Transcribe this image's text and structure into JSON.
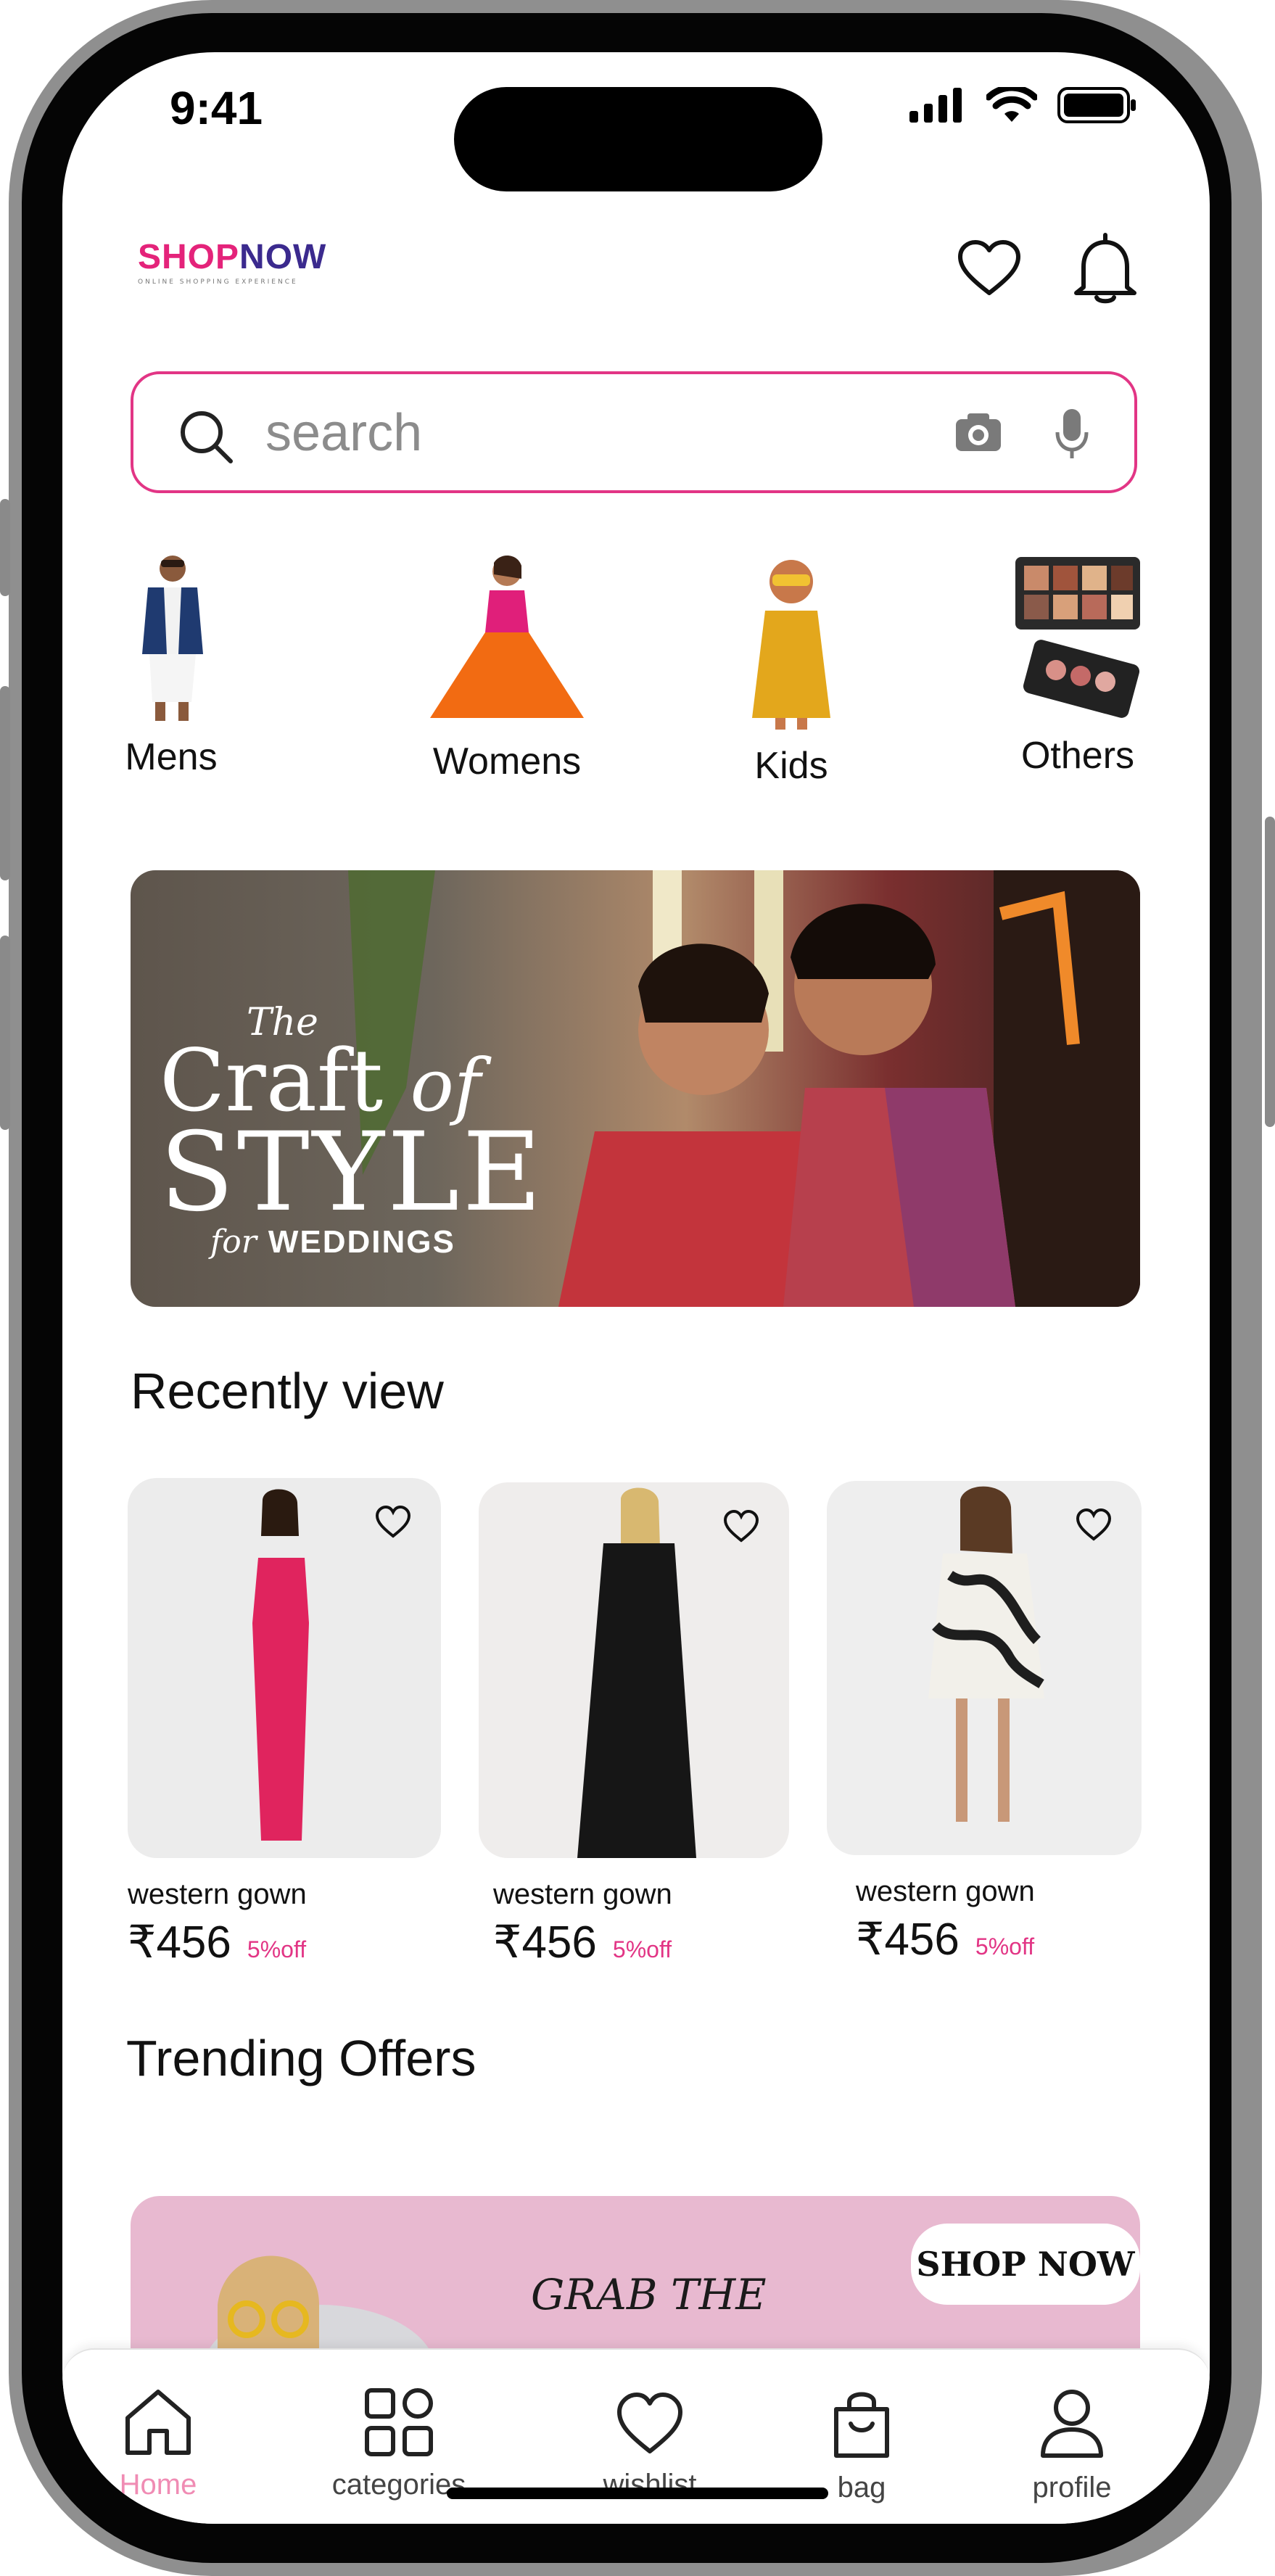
{
  "status": {
    "time": "9:41"
  },
  "header": {
    "logo_shop": "SHOP",
    "logo_now": "NOW",
    "logo_tagline": "ONLINE SHOPPING EXPERIENCE"
  },
  "search": {
    "placeholder": "search"
  },
  "categories": [
    {
      "label": "Mens"
    },
    {
      "label": "Womens"
    },
    {
      "label": "Kids"
    },
    {
      "label": "Others"
    }
  ],
  "banner": {
    "line1": "The",
    "line2a": "Craft",
    "line2b": "of",
    "line3": "STYLE",
    "line4a": "for",
    "line4b": "WEDDINGS"
  },
  "recently_viewed": {
    "title": "Recently view",
    "items": [
      {
        "name": "western gown",
        "price": "₹456",
        "discount": "5%off",
        "dress_color": "#e0245e"
      },
      {
        "name": "western gown",
        "price": "₹456",
        "discount": "5%off",
        "dress_color": "#1a1a1a"
      },
      {
        "name": "western gown",
        "price": "₹456",
        "discount": "5%off",
        "dress_color": "#2b2b2b"
      }
    ]
  },
  "trending": {
    "title": "Trending Offers",
    "offer_text": "GRAB THE",
    "button_label": "SHOP NOW"
  },
  "bottom_nav": [
    {
      "label": "Home",
      "active": true
    },
    {
      "label": "categories",
      "active": false
    },
    {
      "label": "wishlist",
      "active": false
    },
    {
      "label": "bag",
      "active": false
    },
    {
      "label": "profile",
      "active": false
    }
  ],
  "colors": {
    "accent": "#e23585",
    "logo_secondary": "#3b2a8e",
    "active_nav": "#f08cb4",
    "offer_bg": "#e8b9d0"
  }
}
